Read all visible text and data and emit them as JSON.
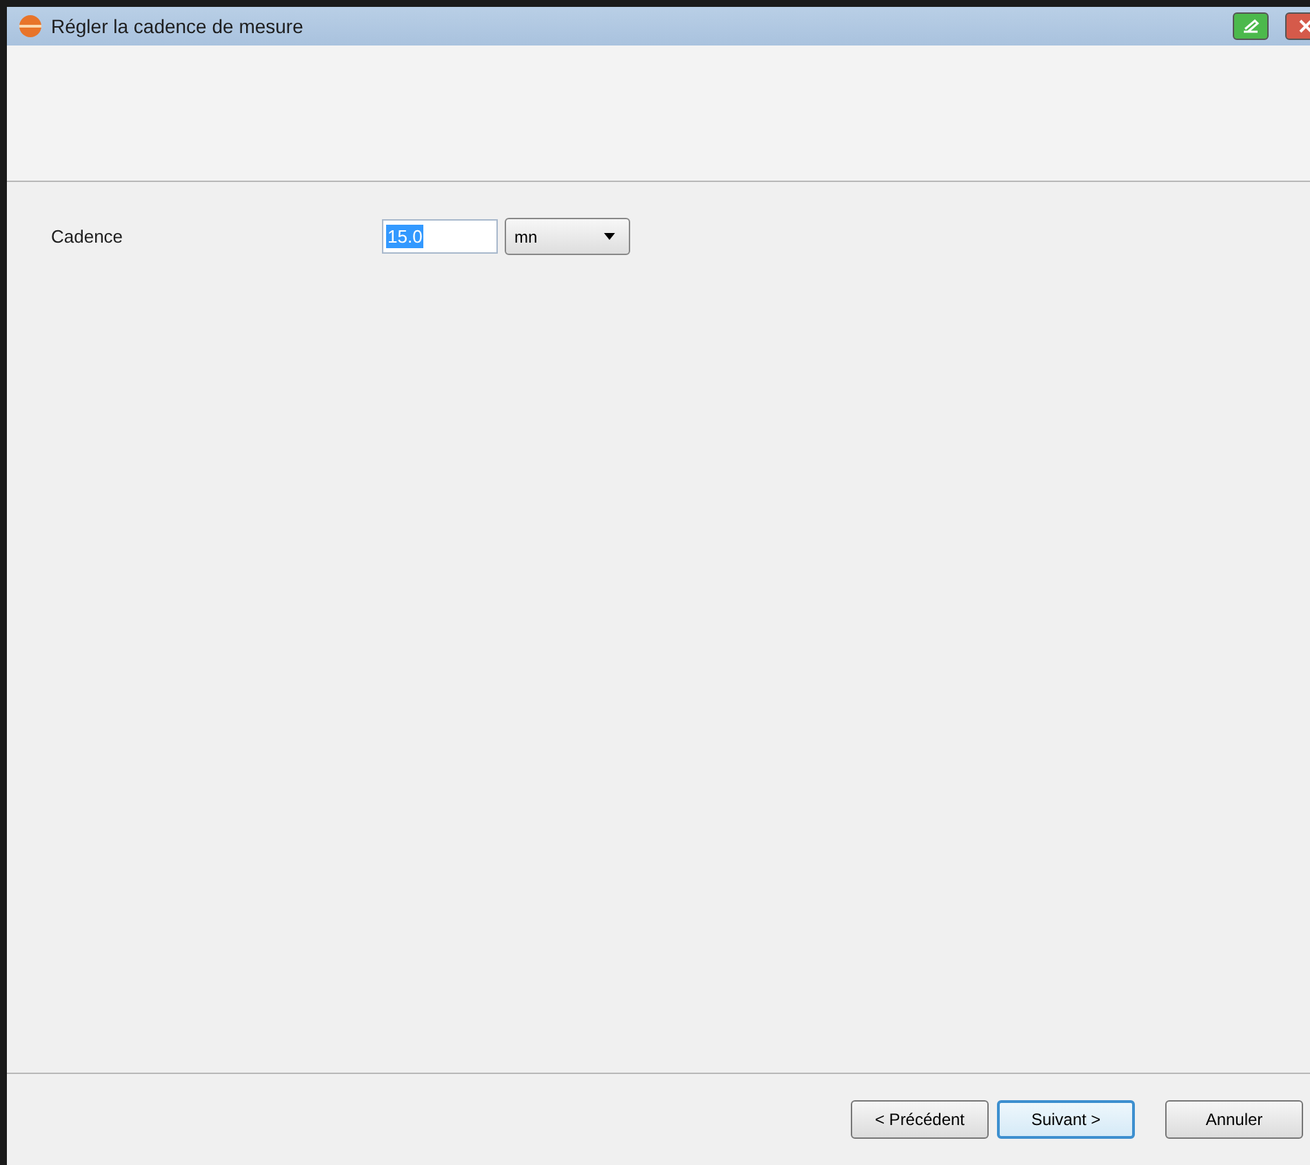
{
  "window": {
    "title": "Régler la cadence de mesure"
  },
  "form": {
    "label": "Cadence",
    "value": "15.0",
    "value_highlighted": true,
    "unit": "mn"
  },
  "buttons": [
    {
      "label": "< Précédent",
      "default": false
    },
    {
      "label": "Suivant >",
      "default": true
    },
    {
      "label": "Annuler",
      "default": false
    }
  ]
}
